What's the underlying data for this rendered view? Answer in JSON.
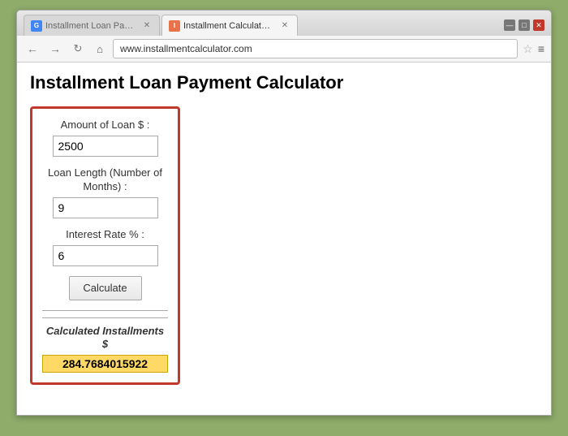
{
  "browser": {
    "tab1_label": "Installment Loan Payment...",
    "tab2_label": "Installment Calculator - Ca...",
    "tab1_favicon": "G",
    "tab2_favicon": "I",
    "address": "www.installmentcalculator.com",
    "window_controls": {
      "minimize": "—",
      "maximize": "□",
      "close": "✕"
    }
  },
  "page": {
    "title": "Installment Loan Payment Calculator"
  },
  "calculator": {
    "loan_amount_label": "Amount of Loan $ :",
    "loan_amount_value": "2500",
    "loan_length_label": "Loan Length (Number of Months) :",
    "loan_length_value": "9",
    "interest_rate_label": "Interest Rate % :",
    "interest_rate_value": "6",
    "calculate_btn_label": "Calculate",
    "result_label": "Calculated Installments $",
    "result_value": "284.7684015922"
  },
  "icons": {
    "back": "←",
    "forward": "→",
    "refresh": "↻",
    "home": "⌂",
    "star": "☆",
    "menu": "≡"
  }
}
